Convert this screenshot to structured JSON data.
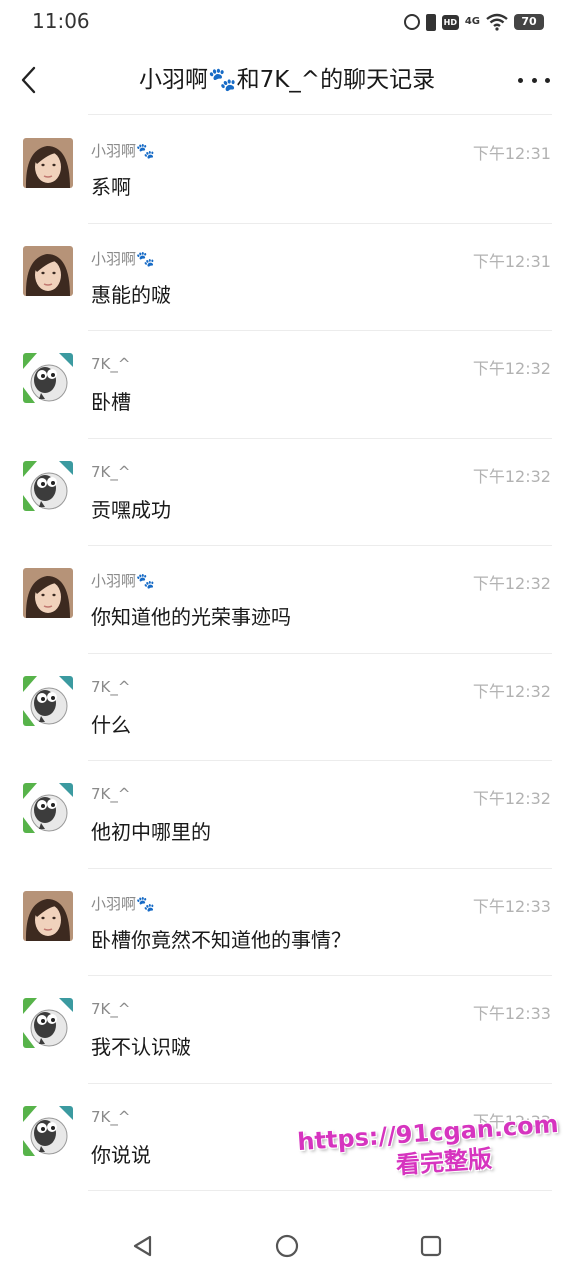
{
  "status_bar": {
    "time": "11:06",
    "network": "4G",
    "hd": "HD",
    "battery": "70"
  },
  "header": {
    "title": "小羽啊🐾和7K_^的聊天记录",
    "back_icon": "chevron-left-icon",
    "more_icon": "more-horizontal-icon"
  },
  "messages": [
    {
      "sender": "小羽啊🐾",
      "avatar": "girl-avatar",
      "time": "下午12:31",
      "text": "系啊"
    },
    {
      "sender": "小羽啊🐾",
      "avatar": "girl-avatar",
      "time": "下午12:31",
      "text": "惠能的啵"
    },
    {
      "sender": "7K_^",
      "avatar": "sheep-avatar",
      "time": "下午12:32",
      "text": "卧槽"
    },
    {
      "sender": "7K_^",
      "avatar": "sheep-avatar",
      "time": "下午12:32",
      "text": "贡嘿成功"
    },
    {
      "sender": "小羽啊🐾",
      "avatar": "girl-avatar",
      "time": "下午12:32",
      "text": "你知道他的光荣事迹吗"
    },
    {
      "sender": "7K_^",
      "avatar": "sheep-avatar",
      "time": "下午12:32",
      "text": "什么"
    },
    {
      "sender": "7K_^",
      "avatar": "sheep-avatar",
      "time": "下午12:32",
      "text": "他初中哪里的"
    },
    {
      "sender": "小羽啊🐾",
      "avatar": "girl-avatar",
      "time": "下午12:33",
      "text": "卧槽你竟然不知道他的事情？"
    },
    {
      "sender": "7K_^",
      "avatar": "sheep-avatar",
      "time": "下午12:33",
      "text": "我不认识啵"
    },
    {
      "sender": "7K_^",
      "avatar": "sheep-avatar",
      "time": "下午12:33",
      "text": "你说说"
    },
    {
      "sender": "7K_^",
      "avatar": "sheep-avatar",
      "time": "",
      "text": ""
    }
  ],
  "watermark": {
    "url": "https://91cgan.com",
    "subtitle": "看完整版"
  },
  "nav_bar": {
    "back_icon": "triangle-back-icon",
    "home_icon": "circle-home-icon",
    "recents_icon": "square-recents-icon"
  },
  "colors": {
    "primary_text": "#191919",
    "secondary_text": "#8a8a8a",
    "time_text": "#b2b2b2",
    "divider": "#ececec",
    "watermark": "#d634bf"
  }
}
